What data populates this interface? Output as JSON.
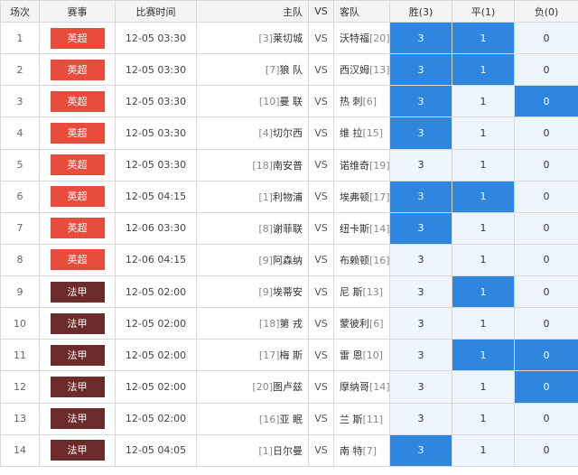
{
  "colors": {
    "epl": "#e84c3d",
    "ligue1": "#6b2b2b",
    "selected": "#2e86de",
    "odd_bg": "#eef5fc"
  },
  "headers": {
    "index": "场次",
    "league": "赛事",
    "time": "比赛时间",
    "home": "主队",
    "vs": "VS",
    "away": "客队",
    "win": "胜(3)",
    "draw": "平(1)",
    "loss": "负(0)"
  },
  "rows": [
    {
      "idx": "1",
      "league": "英超",
      "league_type": "epl",
      "time": "12-05 03:30",
      "home_rank": "[3]",
      "home": "莱切城",
      "vs": "VS",
      "away": "沃特福",
      "away_rank": "[20]",
      "o1": "3",
      "o2": "1",
      "o3": "0",
      "s1": true,
      "s2": true,
      "s3": false
    },
    {
      "idx": "2",
      "league": "英超",
      "league_type": "epl",
      "time": "12-05 03:30",
      "home_rank": "[7]",
      "home": "狼 队",
      "vs": "VS",
      "away": "西汉姆",
      "away_rank": "[13]",
      "o1": "3",
      "o2": "1",
      "o3": "0",
      "s1": true,
      "s2": true,
      "s3": false
    },
    {
      "idx": "3",
      "league": "英超",
      "league_type": "epl",
      "time": "12-05 03:30",
      "home_rank": "[10]",
      "home": "曼 联",
      "vs": "VS",
      "away": "热 刺",
      "away_rank": "[6]",
      "o1": "3",
      "o2": "1",
      "o3": "0",
      "s1": true,
      "s2": false,
      "s3": true
    },
    {
      "idx": "4",
      "league": "英超",
      "league_type": "epl",
      "time": "12-05 03:30",
      "home_rank": "[4]",
      "home": "切尔西",
      "vs": "VS",
      "away": "维 拉",
      "away_rank": "[15]",
      "o1": "3",
      "o2": "1",
      "o3": "0",
      "s1": true,
      "s2": false,
      "s3": false
    },
    {
      "idx": "5",
      "league": "英超",
      "league_type": "epl",
      "time": "12-05 03:30",
      "home_rank": "[18]",
      "home": "南安普",
      "vs": "VS",
      "away": "诺维奇",
      "away_rank": "[19]",
      "o1": "3",
      "o2": "1",
      "o3": "0",
      "s1": false,
      "s2": false,
      "s3": false
    },
    {
      "idx": "6",
      "league": "英超",
      "league_type": "epl",
      "time": "12-05 04:15",
      "home_rank": "[1]",
      "home": "利物浦",
      "vs": "VS",
      "away": "埃弗顿",
      "away_rank": "[17]",
      "o1": "3",
      "o2": "1",
      "o3": "0",
      "s1": true,
      "s2": true,
      "s3": false
    },
    {
      "idx": "7",
      "league": "英超",
      "league_type": "epl",
      "time": "12-06 03:30",
      "home_rank": "[8]",
      "home": "谢菲联",
      "vs": "VS",
      "away": "纽卡斯",
      "away_rank": "[14]",
      "o1": "3",
      "o2": "1",
      "o3": "0",
      "s1": true,
      "s2": false,
      "s3": false
    },
    {
      "idx": "8",
      "league": "英超",
      "league_type": "epl",
      "time": "12-06 04:15",
      "home_rank": "[9]",
      "home": "阿森纳",
      "vs": "VS",
      "away": "布赖顿",
      "away_rank": "[16]",
      "o1": "3",
      "o2": "1",
      "o3": "0",
      "s1": false,
      "s2": false,
      "s3": false
    },
    {
      "idx": "9",
      "league": "法甲",
      "league_type": "ligue1",
      "time": "12-05 02:00",
      "home_rank": "[9]",
      "home": "埃蒂安",
      "vs": "VS",
      "away": "尼 斯",
      "away_rank": "[13]",
      "o1": "3",
      "o2": "1",
      "o3": "0",
      "s1": false,
      "s2": true,
      "s3": false
    },
    {
      "idx": "10",
      "league": "法甲",
      "league_type": "ligue1",
      "time": "12-05 02:00",
      "home_rank": "[18]",
      "home": "第 戎",
      "vs": "VS",
      "away": "蒙彼利",
      "away_rank": "[6]",
      "o1": "3",
      "o2": "1",
      "o3": "0",
      "s1": false,
      "s2": false,
      "s3": false
    },
    {
      "idx": "11",
      "league": "法甲",
      "league_type": "ligue1",
      "time": "12-05 02:00",
      "home_rank": "[17]",
      "home": "梅 斯",
      "vs": "VS",
      "away": "雷 恩",
      "away_rank": "[10]",
      "o1": "3",
      "o2": "1",
      "o3": "0",
      "s1": false,
      "s2": true,
      "s3": true
    },
    {
      "idx": "12",
      "league": "法甲",
      "league_type": "ligue1",
      "time": "12-05 02:00",
      "home_rank": "[20]",
      "home": "图卢兹",
      "vs": "VS",
      "away": "摩纳哥",
      "away_rank": "[14]",
      "o1": "3",
      "o2": "1",
      "o3": "0",
      "s1": false,
      "s2": false,
      "s3": true
    },
    {
      "idx": "13",
      "league": "法甲",
      "league_type": "ligue1",
      "time": "12-05 02:00",
      "home_rank": "[16]",
      "home": "亚 眠",
      "vs": "VS",
      "away": "兰 斯",
      "away_rank": "[11]",
      "o1": "3",
      "o2": "1",
      "o3": "0",
      "s1": false,
      "s2": false,
      "s3": false
    },
    {
      "idx": "14",
      "league": "法甲",
      "league_type": "ligue1",
      "time": "12-05 04:05",
      "home_rank": "[1]",
      "home": "日尔曼",
      "vs": "VS",
      "away": "南 特",
      "away_rank": "[7]",
      "o1": "3",
      "o2": "1",
      "o3": "0",
      "s1": true,
      "s2": false,
      "s3": false
    }
  ]
}
